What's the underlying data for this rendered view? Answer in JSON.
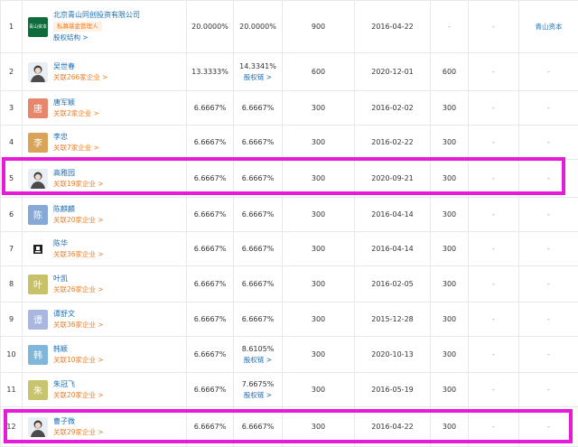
{
  "rows": [
    {
      "idx": "1",
      "kind": "logo",
      "logo_text": "青山资本",
      "name": "北京青山同创投资有限公司",
      "tag": "私募基金管理人",
      "sub": "股权结构 >",
      "p1": "20.0000%",
      "p2": "20.0000%",
      "p2_link": "",
      "amt": "900",
      "date": "2016-04-22",
      "c6": "-",
      "c7": "-",
      "c8": "青山资本"
    },
    {
      "idx": "2",
      "kind": "photo",
      "name": "吴世春",
      "sub": "关联266家企业 >",
      "p1": "13.3333%",
      "p2": "14.3341%",
      "p2_link": "股权链 >",
      "amt": "600",
      "date": "2020-12-01",
      "c6": "600",
      "c7": "-",
      "c8": "-"
    },
    {
      "idx": "3",
      "kind": "char",
      "char": "唐",
      "color": "#e8866b",
      "name": "唐军颖",
      "sub": "关联2家企业 >",
      "p1": "6.6667%",
      "p2": "6.6667%",
      "p2_link": "",
      "amt": "300",
      "date": "2016-02-02",
      "c6": "300",
      "c7": "-",
      "c8": "-"
    },
    {
      "idx": "4",
      "kind": "char",
      "char": "李",
      "color": "#d9a35a",
      "name": "李忠",
      "sub": "关联7家企业 >",
      "p1": "6.6667%",
      "p2": "6.6667%",
      "p2_link": "",
      "amt": "300",
      "date": "2016-02-22",
      "c6": "300",
      "c7": "-",
      "c8": "-"
    },
    {
      "idx": "5",
      "kind": "photo",
      "name": "高雅园",
      "sub": "关联19家企业 >",
      "p1": "6.6667%",
      "p2": "6.6667%",
      "p2_link": "",
      "amt": "300",
      "date": "2020-09-21",
      "c6": "300",
      "c7": "-",
      "c8": "-"
    },
    {
      "idx": "6",
      "kind": "char",
      "char": "陈",
      "color": "#86a8d6",
      "name": "陈麒麟",
      "sub": "关联20家企业 >",
      "p1": "6.6667%",
      "p2": "6.6667%",
      "p2_link": "",
      "amt": "300",
      "date": "2016-04-14",
      "c6": "300",
      "c7": "-",
      "c8": "-"
    },
    {
      "idx": "7",
      "kind": "icon",
      "name": "陈华",
      "sub": "关联36家企业 >",
      "p1": "6.6667%",
      "p2": "6.6667%",
      "p2_link": "",
      "amt": "300",
      "date": "2016-04-14",
      "c6": "300",
      "c7": "-",
      "c8": "-"
    },
    {
      "idx": "8",
      "kind": "char",
      "char": "叶",
      "color": "#c9c16a",
      "name": "叶凯",
      "sub": "关联26家企业 >",
      "p1": "6.6667%",
      "p2": "6.6667%",
      "p2_link": "",
      "amt": "300",
      "date": "2016-02-05",
      "c6": "300",
      "c7": "-",
      "c8": "-"
    },
    {
      "idx": "9",
      "kind": "char",
      "char": "谭",
      "color": "#a9b7e0",
      "name": "谭舒文",
      "sub": "关联36家企业 >",
      "p1": "6.6667%",
      "p2": "6.6667%",
      "p2_link": "",
      "amt": "300",
      "date": "2015-12-28",
      "c6": "300",
      "c7": "-",
      "c8": "-"
    },
    {
      "idx": "10",
      "kind": "char",
      "char": "韩",
      "color": "#7fb6d9",
      "name": "韩颖",
      "sub": "关联10家企业 >",
      "p1": "6.6667%",
      "p2": "8.6105%",
      "p2_link": "股权链 >",
      "amt": "300",
      "date": "2020-10-13",
      "c6": "300",
      "c7": "-",
      "c8": "-"
    },
    {
      "idx": "11",
      "kind": "char",
      "char": "朱",
      "color": "#c8c46e",
      "name": "朱冠飞",
      "sub": "关联20家企业 >",
      "p1": "6.6667%",
      "p2": "7.6675%",
      "p2_link": "股权链 >",
      "amt": "300",
      "date": "2016-05-19",
      "c6": "300",
      "c7": "-",
      "c8": "-"
    },
    {
      "idx": "12",
      "kind": "photo",
      "name": "曹子微",
      "sub": "关联29家企业 >",
      "p1": "6.6667%",
      "p2": "6.6667%",
      "p2_link": "",
      "amt": "300",
      "date": "2016-04-22",
      "c6": "300",
      "c7": "-",
      "c8": "-"
    }
  ]
}
